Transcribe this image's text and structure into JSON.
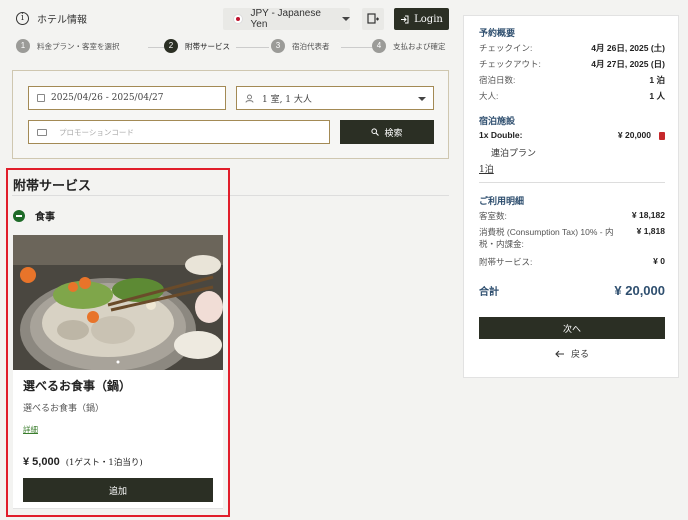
{
  "header": {
    "hotel_info": "ホテル情報",
    "currency": "JPY - Japanese Yen",
    "login": "Login"
  },
  "steps": [
    {
      "num": "1",
      "label": "料金プラン・客室を選択"
    },
    {
      "num": "2",
      "label": "附帯サービス"
    },
    {
      "num": "3",
      "label": "宿泊代表者"
    },
    {
      "num": "4",
      "label": "支払および確定"
    }
  ],
  "search": {
    "dates": "2025/04/26 - 2025/04/27",
    "guests": "1 室, 1 大人",
    "promo_placeholder": "プロモーションコード",
    "search_label": "検索"
  },
  "services": {
    "title": "附帯サービス",
    "category": "食事",
    "card": {
      "title": "選べるお食事（鍋）",
      "subtitle": "選べるお食事（鍋）",
      "details_link": "詳細",
      "price": "¥ 5,000",
      "per": "(1ゲスト・1泊当り)",
      "add_label": "追加"
    }
  },
  "summary": {
    "overview_title": "予約概要",
    "checkin_label": "チェックイン:",
    "checkin_value": "4月 26日, 2025 (土)",
    "checkout_label": "チェックアウト:",
    "checkout_value": "4月 27日, 2025 (日)",
    "nights_label": "宿泊日数:",
    "nights_value": "1 泊",
    "adults_label": "大人:",
    "adults_value": "1 人",
    "facility_title": "宿泊施設",
    "room_label": "1x Double:",
    "room_price": "¥ 20,000",
    "plan_name": "連泊プラン",
    "plan_nights": "1泊",
    "billing_title": "ご利用明細",
    "rooms_label": "客室数:",
    "rooms_value": "¥ 18,182",
    "tax_label": "消費税 (Consumption Tax) 10% - 内税・内課金:",
    "tax_value": "¥ 1,818",
    "services_label": "附帯サービス:",
    "services_value": "¥ 0",
    "total_label": "合計",
    "total_value": "¥ 20,000",
    "next_label": "次へ",
    "back_label": "戻る"
  },
  "colors": {
    "primary_button": "#2b2f24",
    "highlight_border": "#e11e2b",
    "summary_heading": "#2f4f6f",
    "field_border": "#a38a55"
  }
}
